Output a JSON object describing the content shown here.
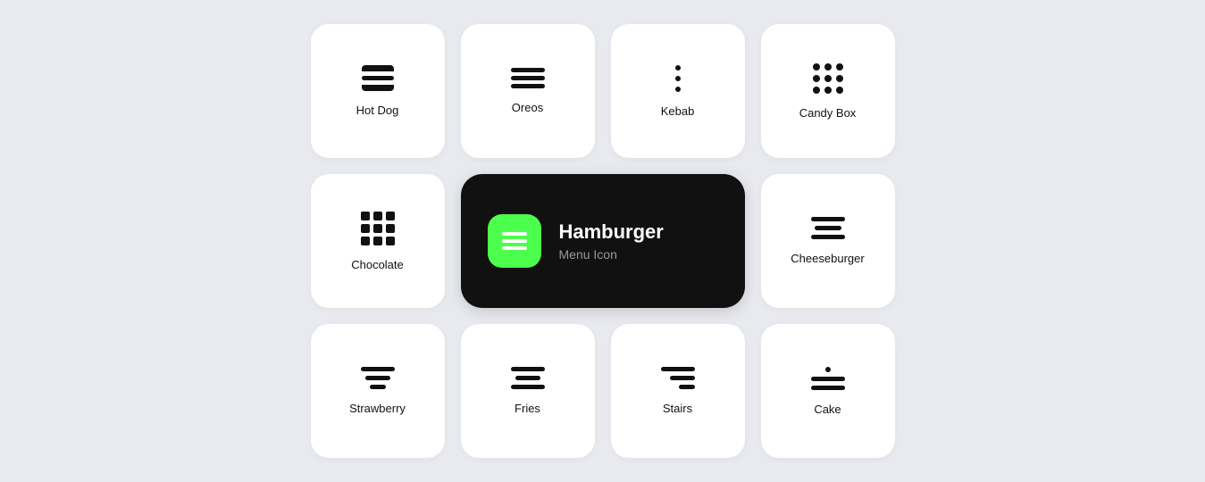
{
  "page": {
    "background": "#e8eaef"
  },
  "cards": [
    {
      "id": "hotdog",
      "label": "Hot Dog",
      "type": "hotdog"
    },
    {
      "id": "oreos",
      "label": "Oreos",
      "type": "oreos"
    },
    {
      "id": "kebab",
      "label": "Kebab",
      "type": "kebab"
    },
    {
      "id": "candybox",
      "label": "Candy Box",
      "type": "candybox"
    },
    {
      "id": "chocolate",
      "label": "Chocolate",
      "type": "chocolate"
    },
    {
      "id": "hamburger",
      "label": "Hamburger",
      "subtitle": "Menu Icon",
      "type": "featured"
    },
    {
      "id": "cheeseburger",
      "label": "Cheeseburger",
      "type": "cheeseburger"
    },
    {
      "id": "strawberry",
      "label": "Strawberry",
      "type": "strawberry"
    },
    {
      "id": "fries",
      "label": "Fries",
      "type": "fries"
    },
    {
      "id": "stairs",
      "label": "Stairs",
      "type": "stairs"
    },
    {
      "id": "cake",
      "label": "Cake",
      "type": "cake"
    }
  ],
  "featured": {
    "title": "Hamburger",
    "subtitle": "Menu Icon"
  }
}
